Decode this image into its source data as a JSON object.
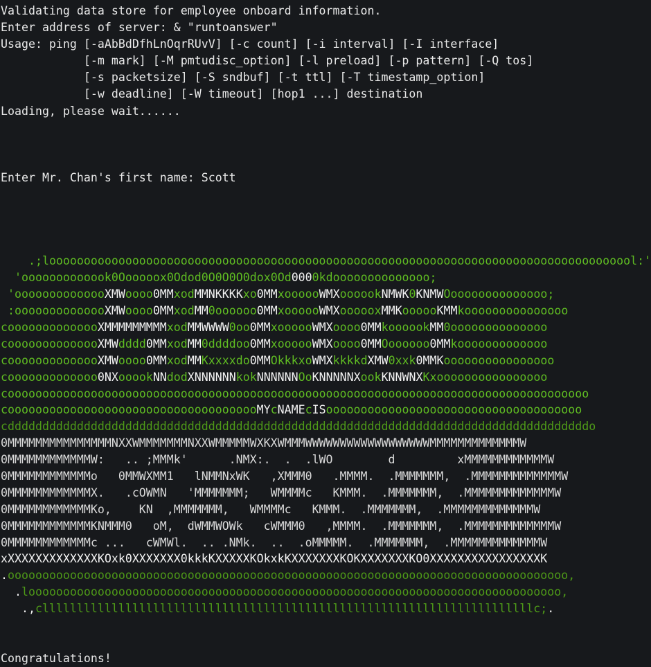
{
  "terminal": {
    "title": "terminal-output",
    "background_color": "#17191c",
    "text_color": "#e6e6e6",
    "green_color": "#4e9a18",
    "bright_green_color": "#5fbc22",
    "white_color": "#d9d9d9"
  },
  "output": {
    "header_lines": [
      "Validating data store for employee onboard information.",
      "Enter address of server: & \"runtoanswer\"",
      "Usage: ping [-aAbBdDfhLnOqrRUvV] [-c count] [-i interval] [-I interface]",
      "            [-m mark] [-M pmtudisc_option] [-l preload] [-p pattern] [-Q tos]",
      "            [-s packetsize] [-S sndbuf] [-t ttl] [-T timestamp_option]",
      "            [-w deadline] [-W timeout] [hop1 ...] destination",
      "Loading, please wait......"
    ],
    "prompt_line": "Enter Mr. Chan's first name: Scott",
    "prompt_label": "Enter Mr. Chan's first name: ",
    "prompt_value": "Scott",
    "footer_line": "Congratulations!"
  },
  "ascii_art": {
    "description": "green-bordered name badge reading MY NAME IS with handwritten name",
    "rows": [
      [
        {
          "t": "    .;l",
          "c": "gb"
        },
        {
          "t": "oooooooooooooooooooooooooooooooooooooooooooooooooooooooooooooooooooooooooooooooooool",
          "c": "gb"
        },
        {
          "t": ":'",
          "c": "gb"
        }
      ],
      [
        {
          "t": "  '",
          "c": "gb"
        },
        {
          "t": "oooooooooooo",
          "c": "gb"
        },
        {
          "t": "k",
          "c": "gb"
        },
        {
          "t": "0O",
          "c": "gb"
        },
        {
          "t": "ooooo",
          "c": "gb"
        },
        {
          "t": "x",
          "c": "gb"
        },
        {
          "t": "0O",
          "c": "gb"
        },
        {
          "t": "d",
          "c": "gb"
        },
        {
          "t": "o",
          "c": "gb"
        },
        {
          "t": "d",
          "c": "gb"
        },
        {
          "t": "0O0O0O0",
          "c": "gb"
        },
        {
          "t": "d",
          "c": "gb"
        },
        {
          "t": "o",
          "c": "gb"
        },
        {
          "t": "x",
          "c": "gb"
        },
        {
          "t": "0O",
          "c": "gb"
        },
        {
          "t": "d",
          "c": "gb"
        },
        {
          "t": "o",
          "c": "gb"
        },
        {
          "t": "d",
          "c": "gb"
        },
        {
          "t": "000",
          "c": "wb"
        },
        {
          "t": "0",
          "c": "gb"
        },
        {
          "t": "k",
          "c": "gb"
        },
        {
          "t": "d",
          "c": "gb"
        },
        {
          "t": "oooooooooooooo",
          "c": "gb"
        },
        {
          "t": ";",
          "c": "gb"
        }
      ]
    ],
    "raw_rows": [
      "    .;loooooooooooooooooooooooooooooooooooooooooooooooooooooooooooooooooooooooooooooooooooooooooooool:'",
      "  'oooooooooooook0Ooooox0Odod0O0O0O0dox0Od000Okdoooooooooooo;",
      " 'oooooooooooooXMWooooOMMxodMMNKKKKxoOMMxooooooWMXooooookNMWK0KNMWOooooooooooooooo;",
      " :oooooooooooooXMWooooOMMxodMM0oooooooOMMxooooooWMXooooxMMKoooooKMMkoooooooooooooooo",
      "coooooooooooooXMMMMMMMMMxodMMWWWW0ooOMMxooooooWMXooooOMMkooooookMM0oooooooooooooooo",
      "coooooooooooooXMWdddd0MMxodMM0ddddooOMMxooooooWMXooooOMMOoooooOMMkoooooooooooooooo",
      "coooooooooooooXMWooooOMMxodMMKxxxxdoOMMOkkkxoWMXkkkkdXMW0xxk0MMKoooooooooooooooooo",
      "cooooooooooooo0NXooookNNdodXNNNNNNkokNNNNNNOoKNNNNNXookKNNWNXKxoooooooooooooooooooo",
      "cooooooooooooooooooooooooooooooooooooooooooooooooooooooooooooooooooooooooooooooooooo",
      "cooooooooooooooooooooooooooooooooooooMYcNAMEcISoooooooooooooooooooooooooooooooooooo",
      "cdddddddddddddddddddddddddddddddddddddddddddddddddddddddddddddddddddddddddddddddddo",
      "OMMMMMMMMMMMMMMMNXXWMMMMMMMNXXWMMMMMWXKXWMMMWWWWWWWWWWWWWWWWWWMMMMMMMMMMMMMW",
      "OMMMMMMMMMMMMW:   .. ;MMMk'      .NMX:.  .  .lWO        d         xMMMMMMMMMMMMW",
      "OMMMMMMMMMMMMo   OMMWXMM1   lNMMNxWK   ,XMMMO   .MMMM.  .MMMMMMM,  .MMMMMMMMMMMMMW",
      "OMMMMMMMMMMMMX.   .cOWMN   'MMMMMMM;   WMMMMc   KMMM.  .MMMMMMM,  .MMMMMMMMMMMMMW",
      "OMMMMMMMMMMMMKo,    KN  ,MMMMMMM,   WMMMMc   KMMM.  .MMMMMMM,  .MMMMMMMMMMMMMW",
      "OMMMMMMMMMMMMKNMMMO   oM,  dWMMWOWk   cWMMMO   ,MMMM.  .MMMMMMM,  .MMMMMMMMMMMMMW",
      "OMMMMMMMMMMMMc ...   cWMWl.  .. .NMk.  ..  .oMMMMM.  .MMMMMMM,  .MMMMMMMMMMMMMW",
      "xXXXXXXXXXXXXXKOxk0XXXXXXX0kkkKXXXXXKOkxkKXXXXXXXKOKXXXXXXXKO0XXXXXXXXXXXXXXXXK",
      ".ooooooooooooooooooooooooooooooooooooooooooooooooooooooooooooooooooooooooooooooooo,",
      " .looooooooooooooooooooooooooooooooooooooooooooooooooooooooooooooooooooooooooooo,",
      "   .,clllllllllllllllllllllllllllllllllllllllllllllllllllllllllllllllllllllc;."
    ],
    "badge_text": "MY NAME IS"
  }
}
